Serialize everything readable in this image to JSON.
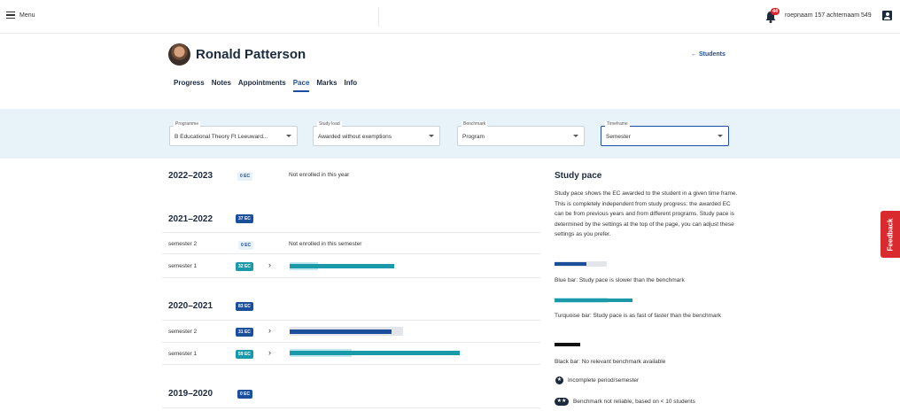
{
  "topbar": {
    "menu_label": "Menu",
    "notification_count": "44",
    "user_name": "roepnaam 157 achternaam 549"
  },
  "student": {
    "name": "Ronald Patterson",
    "back_label": "← Students"
  },
  "tabs": [
    {
      "label": "Progress"
    },
    {
      "label": "Notes"
    },
    {
      "label": "Appointments"
    },
    {
      "label": "Pace"
    },
    {
      "label": "Marks"
    },
    {
      "label": "Info"
    }
  ],
  "active_tab": "Pace",
  "filters": {
    "programme": {
      "label": "Programme",
      "value": "B Educational Theory Ft Leeuward..."
    },
    "study_load": {
      "label": "Study load",
      "value": "Awarded without exemptions"
    },
    "benchmark": {
      "label": "Benchmark",
      "value": "Program"
    },
    "timeframe": {
      "label": "Timeframe",
      "value": "Semester"
    }
  },
  "years": [
    {
      "year": "2022–2023",
      "ec": "0 EC",
      "note": "Not enrolled in this year"
    },
    {
      "year": "2021–2022",
      "ec": "37 EC",
      "semesters": [
        {
          "label": "semester 2",
          "ec": "0 EC",
          "note": "Not enrolled in this semester"
        },
        {
          "label": "semester 1",
          "ec": "32 EC",
          "progress": 0.37,
          "benchmark": 0.1,
          "color": "#1a9aa8"
        }
      ]
    },
    {
      "year": "2020–2021",
      "ec": "83 EC",
      "semesters": [
        {
          "label": "semester 2",
          "ec": "31 EC",
          "progress": 0.36,
          "benchmark": 0.4,
          "color": "#1b4e9b"
        },
        {
          "label": "semester 1",
          "ec": "59 EC",
          "progress": 0.6,
          "benchmark": 0.22,
          "color": "#1a9aa8"
        }
      ]
    },
    {
      "year": "2019–2020",
      "ec": "0 EC"
    }
  ],
  "study_pace": {
    "title": "Study pace",
    "description": "Study pace shows the EC awarded to the student in a given time frame. This is completely independent from study progress: the awarded EC can be from previous years and from different programs. Study pace is determined by the settings at the top of the page, you can adjust these settings as you prefer.",
    "legend": {
      "blue": "Blue bar: Study pace is slower than the benchmark",
      "turquoise": "Turquoise bar: Study pace is as fast of faster than the benchmark",
      "black": "Black bar: No relevant benchmark available",
      "incomplete": "Incomplete period/semester",
      "unreliable": "Benchmark not reliable, based on < 10 students"
    }
  },
  "feedback_label": "Feedback",
  "colors": {
    "blue": "#1b4e9b",
    "turquoise": "#1a9aa8",
    "track": "#e2e6ea",
    "benchmark_light": "#bfe7ee",
    "feedback": "#d92a2f"
  }
}
